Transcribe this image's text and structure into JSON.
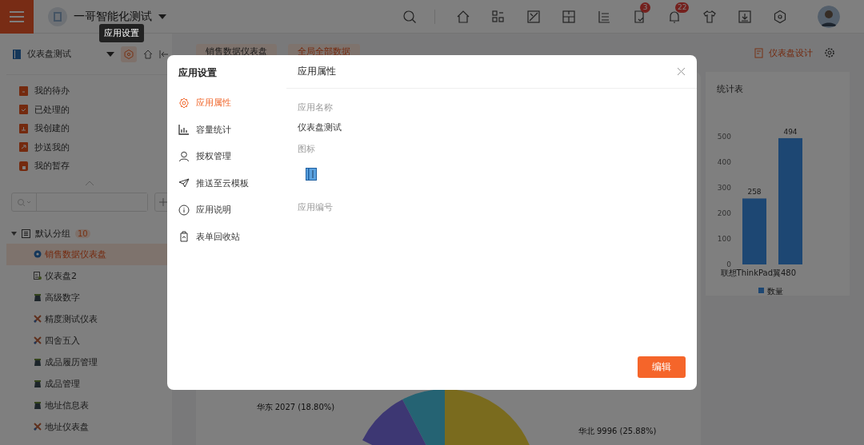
{
  "topbar": {
    "app_title": "一哥智能化测试",
    "toolbar": [
      {
        "kind": "search"
      },
      {
        "kind": "home"
      },
      {
        "kind": "apps"
      },
      {
        "kind": "chart"
      },
      {
        "kind": "grid"
      },
      {
        "kind": "list"
      },
      {
        "kind": "doc",
        "badge": "3"
      },
      {
        "kind": "bell",
        "badge": "22"
      },
      {
        "kind": "shirt"
      },
      {
        "kind": "download"
      },
      {
        "kind": "hexagon"
      }
    ]
  },
  "tooltip": "应用设置",
  "sidebar": {
    "app_name": "仪表盘测试",
    "quick_items": [
      {
        "label": "我的待办"
      },
      {
        "label": "已处理的"
      },
      {
        "label": "我创建的"
      },
      {
        "label": "抄送我的"
      },
      {
        "label": "我的暂存"
      }
    ],
    "tree": [
      {
        "label": "默认分组",
        "count": "10",
        "expanded": true,
        "children": [
          {
            "label": "销售数据仪表盘",
            "kind": "dashboard",
            "selected": true
          },
          {
            "label": "仪表盘2",
            "kind": "chart",
            "selected": false
          },
          {
            "label": "高级数字",
            "kind": "form",
            "selected": false
          },
          {
            "label": "精度测试仪表",
            "kind": "tools",
            "selected": false
          },
          {
            "label": "四舍五入",
            "kind": "tools",
            "selected": false
          },
          {
            "label": "成品履历管理",
            "kind": "form",
            "selected": false
          },
          {
            "label": "成品管理",
            "kind": "form",
            "selected": false
          },
          {
            "label": "地址信息表",
            "kind": "form",
            "selected": false
          },
          {
            "label": "地址仪表盘",
            "kind": "tools",
            "selected": false
          }
        ]
      }
    ]
  },
  "main": {
    "tabs": [
      {
        "label": "销售数据仪表盘",
        "selected": false
      },
      {
        "label": "全局全部数据",
        "selected": true
      }
    ],
    "design_link": "仪表盘设计",
    "chart_card": {
      "title": "统计表",
      "chart_data": {
        "type": "bar",
        "categories": [
          "联想ThinkPad",
          "翼480"
        ],
        "series": [
          {
            "name": "数量",
            "color": "#3a8ee6",
            "values": [
              258,
              494
            ]
          }
        ],
        "ylim": [
          0,
          500
        ],
        "yticks": [
          0,
          100,
          200,
          300,
          400,
          500
        ],
        "data_labels": true
      }
    },
    "pie_labels": [
      "华东 2027 (18.80%)",
      "华北 9996 (25.88%)"
    ]
  },
  "modal": {
    "title": "应用设置",
    "nav": [
      {
        "label": "应用属性",
        "kind": "gear",
        "selected": true
      },
      {
        "label": "容量统计",
        "kind": "bars",
        "selected": false
      },
      {
        "label": "授权管理",
        "kind": "user",
        "selected": false
      },
      {
        "label": "推送至云模板",
        "kind": "plane",
        "selected": false
      },
      {
        "label": "应用说明",
        "kind": "info",
        "selected": false
      },
      {
        "label": "表单回收站",
        "kind": "bin",
        "selected": false
      }
    ],
    "section_title": "应用属性",
    "fields": [
      {
        "label": "应用名称",
        "kind": "text",
        "value": "仪表盘测试"
      },
      {
        "label": "图标",
        "kind": "icon"
      },
      {
        "label": "应用编号",
        "kind": "text"
      }
    ],
    "button": "编辑"
  }
}
